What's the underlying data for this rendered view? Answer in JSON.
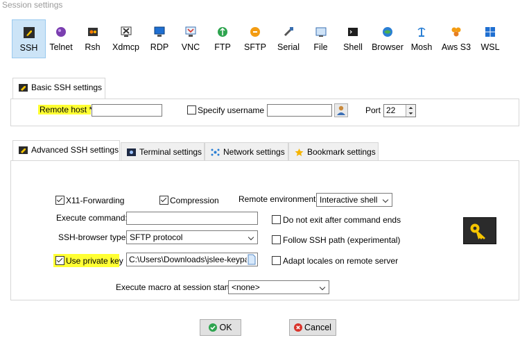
{
  "window": {
    "title": "Session settings"
  },
  "toolbar": [
    {
      "label": "SSH",
      "icon": "ssh-icon",
      "selected": true
    },
    {
      "label": "Telnet",
      "icon": "telnet-icon"
    },
    {
      "label": "Rsh",
      "icon": "rsh-icon"
    },
    {
      "label": "Xdmcp",
      "icon": "xdmcp-icon"
    },
    {
      "label": "RDP",
      "icon": "rdp-icon"
    },
    {
      "label": "VNC",
      "icon": "vnc-icon"
    },
    {
      "label": "FTP",
      "icon": "ftp-icon"
    },
    {
      "label": "SFTP",
      "icon": "sftp-icon"
    },
    {
      "label": "Serial",
      "icon": "serial-icon"
    },
    {
      "label": "File",
      "icon": "file-icon"
    },
    {
      "label": "Shell",
      "icon": "shell-icon"
    },
    {
      "label": "Browser",
      "icon": "browser-icon"
    },
    {
      "label": "Mosh",
      "icon": "mosh-icon"
    },
    {
      "label": "Aws S3",
      "icon": "aws-s3-icon"
    },
    {
      "label": "WSL",
      "icon": "wsl-icon"
    }
  ],
  "basic": {
    "tab_label": "Basic SSH settings",
    "remote_host_label": "Remote host *",
    "remote_host_value": "",
    "specify_username_label": "Specify username",
    "specify_username_checked": false,
    "username_value": "",
    "port_label": "Port",
    "port_value": "22"
  },
  "advanced_tabs": [
    {
      "label": "Advanced SSH settings",
      "icon": "ssh-icon",
      "active": true
    },
    {
      "label": "Terminal settings",
      "icon": "terminal-icon"
    },
    {
      "label": "Network settings",
      "icon": "network-icon"
    },
    {
      "label": "Bookmark settings",
      "icon": "star-icon"
    }
  ],
  "advanced": {
    "x11_label": "X11-Forwarding",
    "x11_checked": true,
    "compression_label": "Compression",
    "compression_checked": true,
    "remote_env_label": "Remote environment:",
    "remote_env_value": "Interactive shell",
    "execute_command_label": "Execute command:",
    "execute_command_value": "",
    "do_not_exit_label": "Do not exit after command ends",
    "do_not_exit_checked": false,
    "ssh_browser_label": "SSH-browser type:",
    "ssh_browser_value": "SFTP protocol",
    "follow_ssh_label": "Follow SSH path (experimental)",
    "follow_ssh_checked": false,
    "use_private_key_label": "Use private key",
    "use_private_key_checked": true,
    "private_key_value": "C:\\Users\\Downloads\\jslee-keypair.",
    "adapt_locales_label": "Adapt locales on remote server",
    "adapt_locales_checked": false,
    "execute_macro_label": "Execute macro at session start:",
    "execute_macro_value": "<none>"
  },
  "buttons": {
    "ok": "OK",
    "cancel": "Cancel"
  },
  "colors": {
    "highlight": "#ffff33",
    "selected_tab": "#cce4f7",
    "key_button": "#2b2b2b",
    "key_color": "#f5c400"
  }
}
